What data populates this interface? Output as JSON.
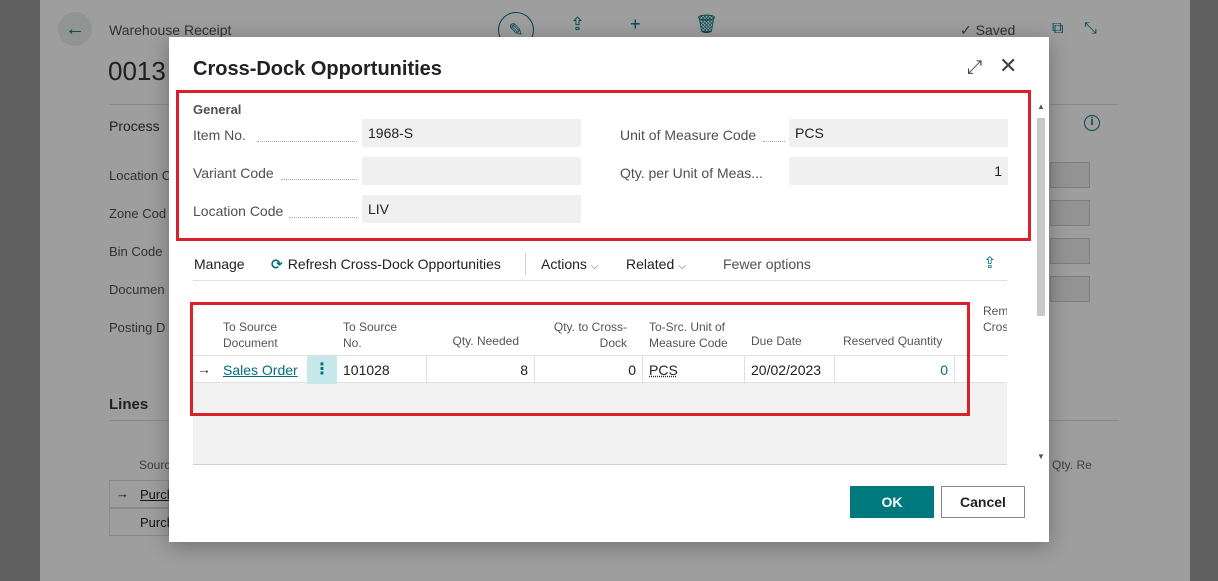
{
  "background": {
    "page_title": "Warehouse Receipt",
    "document_number": "0013",
    "saved_label": "✓ Saved",
    "process_label": "Process",
    "fields": [
      "Location C",
      "Zone Cod",
      "Bin Code",
      "Documen",
      "Posting D"
    ],
    "lines_label": "Lines",
    "source_label": "Sourc",
    "qty_label": "Qty. Re",
    "row_values": [
      "Purch",
      "Purch"
    ]
  },
  "dialog": {
    "title": "Cross-Dock Opportunities",
    "general": {
      "section_label": "General",
      "item_no_label": "Item No.",
      "item_no_value": "1968-S",
      "variant_code_label": "Variant Code",
      "variant_code_value": "",
      "location_code_label": "Location Code",
      "location_code_value": "LIV",
      "uom_code_label": "Unit of Measure Code",
      "uom_code_value": "PCS",
      "qty_per_uom_label": "Qty. per Unit of Meas...",
      "qty_per_uom_value": "1"
    },
    "actions": {
      "manage": "Manage",
      "refresh": "Refresh Cross-Dock Opportunities",
      "actions": "Actions",
      "related": "Related",
      "fewer_options": "Fewer options"
    },
    "grid": {
      "headers": {
        "to_source_document": "To Source Document",
        "to_source_no": "To Source No.",
        "qty_needed": "Qty. Needed",
        "qty_to_cross_dock": "Qty. to Cross-Dock",
        "to_src_uom": "To-Src. Unit of Measure Code",
        "due_date": "Due Date",
        "reserved_quantity": "Reserved Quantity",
        "rem_cross": "Rem. Cros"
      },
      "rows": [
        {
          "to_source_document": "Sales Order",
          "to_source_no": "101028",
          "qty_needed": "8",
          "qty_to_cross_dock": "0",
          "to_src_uom": "PCS",
          "due_date": "20/02/2023",
          "reserved_quantity": "0"
        }
      ]
    },
    "buttons": {
      "ok": "OK",
      "cancel": "Cancel"
    }
  },
  "colors": {
    "accent": "#00707a",
    "highlight": "#d9202b",
    "ok_button": "#00797e"
  }
}
